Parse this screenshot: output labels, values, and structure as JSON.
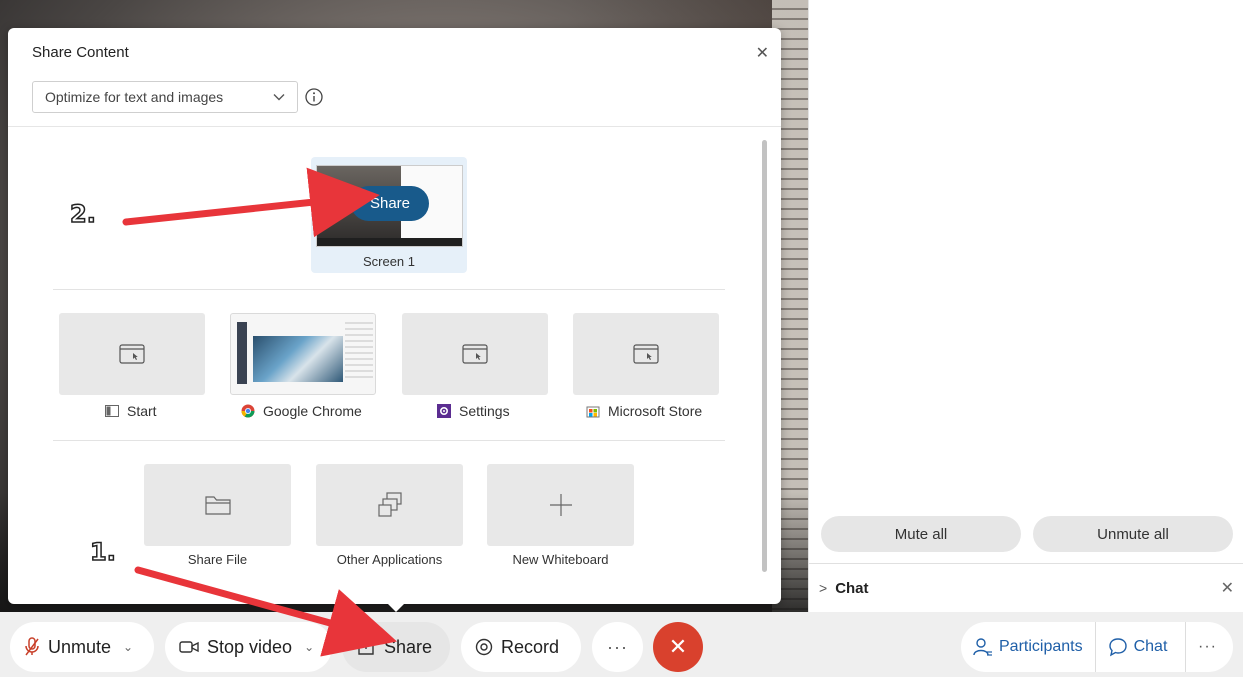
{
  "dialog": {
    "title": "Share Content",
    "optimize_select": "Optimize for text and images",
    "screen": {
      "share_label": "Share",
      "label": "Screen 1"
    },
    "apps": [
      {
        "label": "Start",
        "icon": "window-icon"
      },
      {
        "label": "Google Chrome",
        "icon": "chrome-icon"
      },
      {
        "label": "Settings",
        "icon": "settings-icon"
      },
      {
        "label": "Microsoft Store",
        "icon": "store-icon"
      }
    ],
    "actions": [
      {
        "label": "Share File",
        "icon": "folder-icon"
      },
      {
        "label": "Other Applications",
        "icon": "windows-stack-icon"
      },
      {
        "label": "New Whiteboard",
        "icon": "plus-icon"
      }
    ]
  },
  "side_panel": {
    "mute_all": "Mute all",
    "unmute_all": "Unmute all",
    "chat_title": "Chat"
  },
  "toolbar": {
    "unmute": "Unmute",
    "stop_video": "Stop video",
    "share": "Share",
    "record": "Record",
    "more": "···",
    "participants": "Participants",
    "chat": "Chat",
    "right_more": "···"
  },
  "annotations": {
    "step1": "1.",
    "step2": "2."
  },
  "colors": {
    "accent": "#185a8b",
    "end_call": "#d9412d",
    "arrow": "#e8353a",
    "link": "#1f5fa8"
  }
}
